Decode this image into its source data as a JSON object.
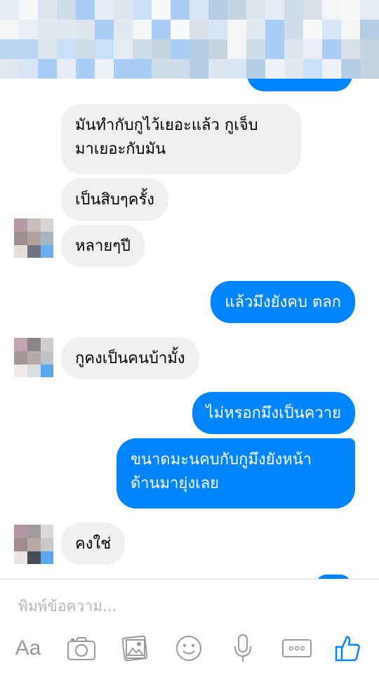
{
  "messages": [
    {
      "side": "in",
      "text": "มันทำกับกูไว้เยอะแล้ว กูเจ็บ",
      "text2": "มาเยอะกับมัน"
    },
    {
      "side": "in",
      "text": "เป็นสิบๆครั้ง"
    },
    {
      "side": "in",
      "text": "หลายๆปี"
    },
    {
      "side": "out",
      "text": "แล้วมึงยังคบ ตลก"
    },
    {
      "side": "in",
      "text": "กูคงเป็นคนบ้ามั้ง"
    },
    {
      "side": "out",
      "text": "ไม่หรอกมึงเป็นควาย"
    },
    {
      "side": "out",
      "text": "ขนาดมะนคบกับกูมึงยังหน้า",
      "text2": "ด้านมายุ่งเลย"
    },
    {
      "side": "in",
      "text": "คงใช่"
    }
  ],
  "composer": {
    "placeholder": "พิมพ์ข้อความ...",
    "aa_label": "Aa"
  },
  "icons": [
    "aa-icon",
    "camera-icon",
    "gallery-icon",
    "emoji-icon",
    "microphone-icon",
    "more-icon",
    "like-icon"
  ],
  "colors": {
    "accent": "#0084ff",
    "incoming": "#f1f0f0",
    "icon_gray": "#9a9a9a"
  }
}
